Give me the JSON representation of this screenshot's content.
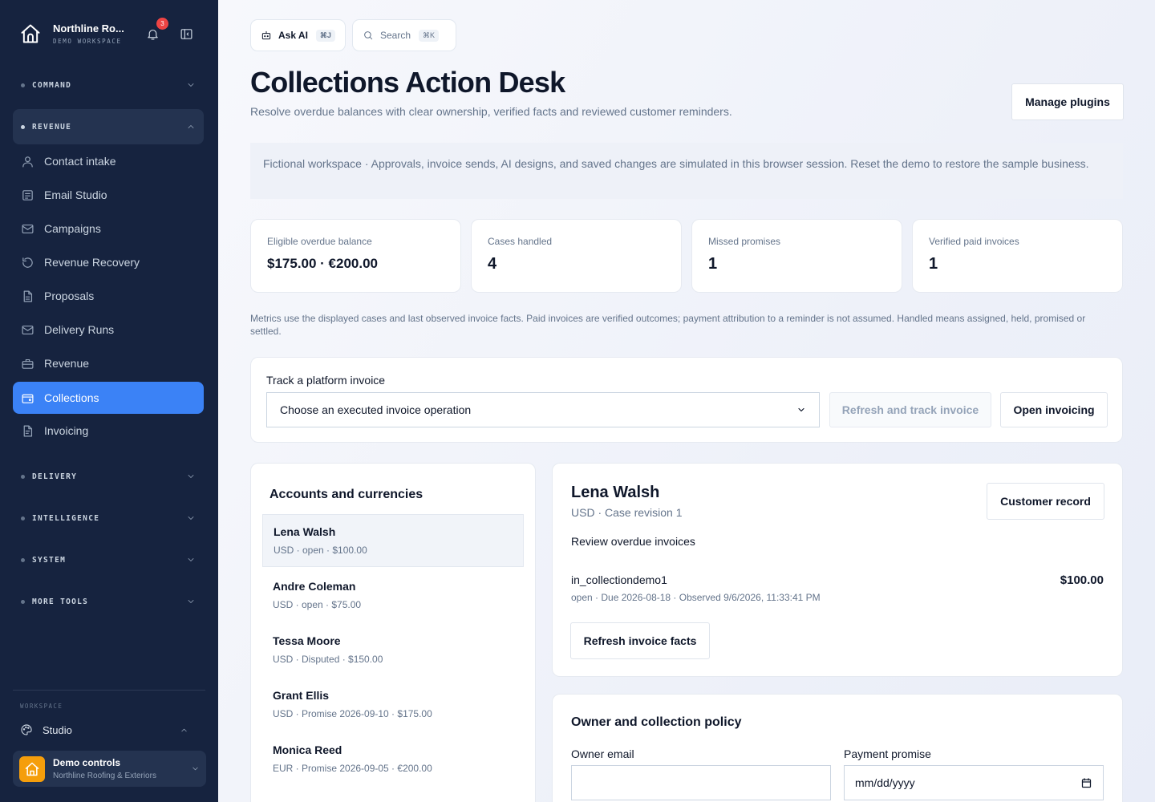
{
  "brand": {
    "name": "Northline Ro...",
    "subtitle": "DEMO WORKSPACE",
    "notification_count": "3"
  },
  "sidebar": {
    "sections": {
      "command": "COMMAND",
      "revenue": "REVENUE",
      "delivery": "DELIVERY",
      "intelligence": "INTELLIGENCE",
      "system": "SYSTEM",
      "more_tools": "MORE TOOLS"
    },
    "items": [
      {
        "label": "Contact intake",
        "icon": "user-icon"
      },
      {
        "label": "Email Studio",
        "icon": "document-icon"
      },
      {
        "label": "Campaigns",
        "icon": "mail-icon"
      },
      {
        "label": "Revenue Recovery",
        "icon": "refresh-icon"
      },
      {
        "label": "Proposals",
        "icon": "file-icon"
      },
      {
        "label": "Delivery Runs",
        "icon": "mail-icon"
      },
      {
        "label": "Revenue",
        "icon": "briefcase-icon"
      },
      {
        "label": "Collections",
        "icon": "wallet-icon",
        "active": true
      },
      {
        "label": "Invoicing",
        "icon": "invoice-icon"
      }
    ],
    "workspace_label": "WORKSPACE",
    "studio": "Studio",
    "demo": {
      "title": "Demo controls",
      "subtitle": "Northline Roofing & Exteriors"
    }
  },
  "topbar": {
    "ask_ai": "Ask AI",
    "ask_ai_shortcut": "⌘J",
    "search": "Search",
    "search_shortcut": "⌘K"
  },
  "page": {
    "title": "Collections Action Desk",
    "subtitle": "Resolve overdue balances with clear ownership, verified facts and reviewed customer reminders.",
    "manage_plugins": "Manage plugins",
    "notice": "Fictional workspace · Approvals, invoice sends, AI designs, and saved changes are simulated in this browser session. Reset the demo to restore the sample business."
  },
  "metrics": [
    {
      "label": "Eligible overdue balance",
      "value": "$175.00 · €200.00"
    },
    {
      "label": "Cases handled",
      "value": "4"
    },
    {
      "label": "Missed promises",
      "value": "1"
    },
    {
      "label": "Verified paid invoices",
      "value": "1"
    }
  ],
  "metrics_note": "Metrics use the displayed cases and last observed invoice facts. Paid invoices are verified outcomes; payment attribution to a reminder is not assumed. Handled means assigned, held, promised or settled.",
  "track": {
    "label": "Track a platform invoice",
    "select_value": "Choose an executed invoice operation",
    "refresh_button": "Refresh and track invoice",
    "open_button": "Open invoicing"
  },
  "accounts": {
    "title": "Accounts and currencies",
    "list": [
      {
        "name": "Lena Walsh",
        "meta": "USD · open · $100.00"
      },
      {
        "name": "Andre Coleman",
        "meta": "USD · open · $75.00"
      },
      {
        "name": "Tessa Moore",
        "meta": "USD · Disputed · $150.00"
      },
      {
        "name": "Grant Ellis",
        "meta": "USD · Promise 2026-09-10 · $175.00"
      },
      {
        "name": "Monica Reed",
        "meta": "EUR · Promise 2026-09-05 · €200.00"
      }
    ]
  },
  "detail": {
    "name": "Lena Walsh",
    "meta": "USD · Case revision 1",
    "customer_record": "Customer record",
    "status": "Review overdue invoices",
    "invoice_id": "in_collectiondemo1",
    "invoice_amount": "$100.00",
    "invoice_meta": "open · Due 2026-08-18 · Observed 9/6/2026, 11:33:41 PM",
    "refresh_facts": "Refresh invoice facts"
  },
  "policy": {
    "title": "Owner and collection policy",
    "owner_email_label": "Owner email",
    "owner_email_value": "",
    "payment_promise_label": "Payment promise",
    "payment_promise_placeholder": "mm/dd/yyyy"
  },
  "colors": {
    "sidebar_bg": "#16233f",
    "accent": "#3b82f6",
    "badge": "#ef4444",
    "demo_logo": "#f59e0b"
  }
}
